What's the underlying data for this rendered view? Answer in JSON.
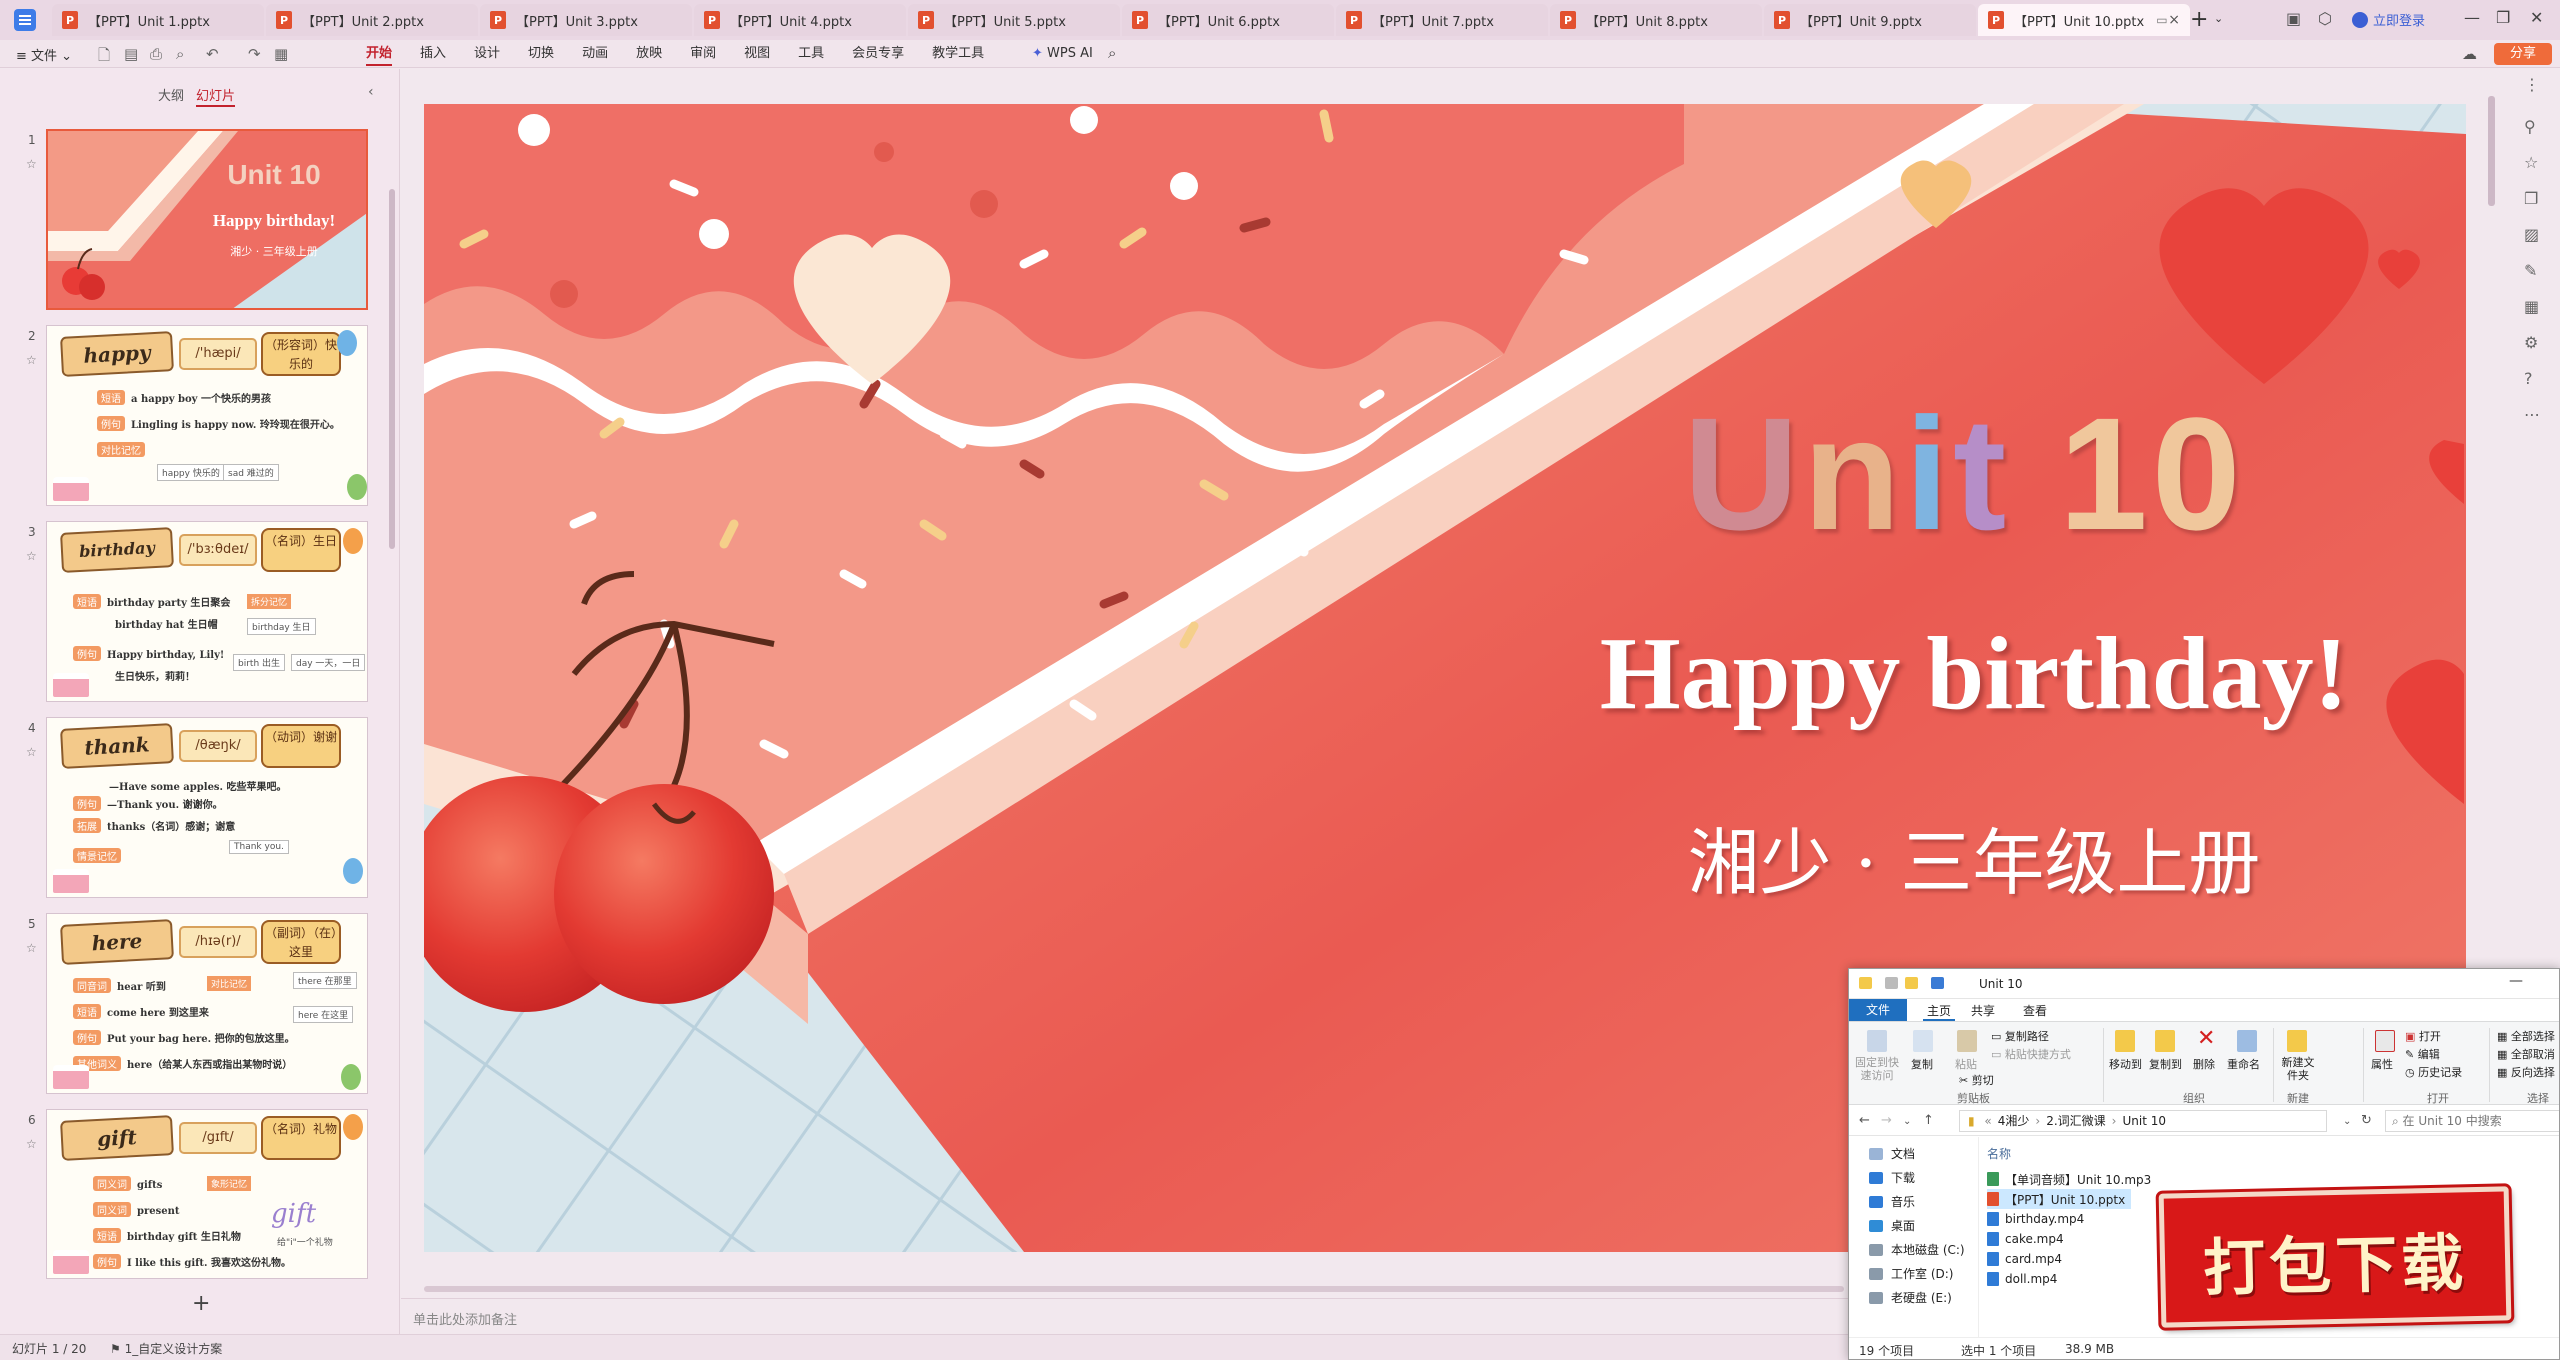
{
  "tabbar": {
    "tabs": [
      {
        "label": "【PPT】Unit 1.pptx",
        "icon": "ppt-icon"
      },
      {
        "label": "【PPT】Unit 2.pptx",
        "icon": "ppt-icon"
      },
      {
        "label": "【PPT】Unit 3.pptx",
        "icon": "ppt-icon"
      },
      {
        "label": "【PPT】Unit 4.pptx",
        "icon": "ppt-icon"
      },
      {
        "label": "【PPT】Unit 5.pptx",
        "icon": "ppt-icon"
      },
      {
        "label": "【PPT】Unit 6.pptx",
        "icon": "ppt-icon"
      },
      {
        "label": "【PPT】Unit 7.pptx",
        "icon": "ppt-icon"
      },
      {
        "label": "【PPT】Unit 8.pptx",
        "icon": "ppt-icon"
      },
      {
        "label": "【PPT】Unit 9.pptx",
        "icon": "ppt-icon"
      },
      {
        "label": "【PPT】Unit 10.pptx",
        "icon": "ppt-icon",
        "active": true
      }
    ],
    "ppt_icon_letter": "P",
    "login_label": "立即登录"
  },
  "menubar": {
    "file_label": "≡ 文件 ⌄",
    "menus": [
      "开始",
      "插入",
      "设计",
      "切换",
      "动画",
      "放映",
      "审阅",
      "视图",
      "工具",
      "会员专享",
      "教学工具"
    ],
    "active_menu": "开始",
    "wps_ai_label": "WPS AI",
    "share_label": "分享"
  },
  "leftpanel": {
    "tab_outline": "大纲",
    "tab_slides": "幻灯片",
    "slides": [
      {
        "num": "1",
        "unit": "Unit 10",
        "happy": "Happy birthday!",
        "cn": "湘少 · 三年级上册"
      },
      {
        "num": "2",
        "word": "happy",
        "phonetic": "/'hæpi/",
        "pos": "（形容词）快乐的",
        "lines": [
          {
            "label": "短语",
            "text": "a happy boy 一个快乐的男孩"
          },
          {
            "label": "例句",
            "text": "Lingling is happy now. 玲玲现在很开心。"
          },
          {
            "label": "对比记忆",
            "text": ""
          }
        ],
        "notes": [
          "happy 快乐的",
          "sad 难过的"
        ]
      },
      {
        "num": "3",
        "word": "birthday",
        "phonetic": "/'bɜːθdeɪ/",
        "pos": "（名词）生日",
        "lines": [
          {
            "label": "短语",
            "text": "birthday party 生日聚会"
          },
          {
            "label": "",
            "text": "birthday hat 生日帽"
          },
          {
            "label": "例句",
            "text": "Happy birthday, Lily!"
          },
          {
            "label": "",
            "text": "生日快乐，莉莉！"
          }
        ],
        "notes": [
          "拆分记忆",
          "birthday 生日",
          "birth 出生",
          "day 一天，一日"
        ]
      },
      {
        "num": "4",
        "word": "thank",
        "phonetic": "/θæŋk/",
        "pos": "（动词）谢谢",
        "lines": [
          {
            "label": "例句",
            "text": "—Have some apples. 吃些苹果吧。"
          },
          {
            "label": "",
            "text": "—Thank you. 谢谢你。"
          },
          {
            "label": "拓展",
            "text": "thanks（名词）感谢；谢意"
          },
          {
            "label": "情景记忆",
            "text": ""
          }
        ],
        "notes": [
          "Thank you."
        ]
      },
      {
        "num": "5",
        "word": "here",
        "phonetic": "/hɪə(r)/",
        "pos": "（副词）（在）这里",
        "lines": [
          {
            "label": "同音词",
            "text": "hear 听到"
          },
          {
            "label": "短语",
            "text": "come here 到这里来"
          },
          {
            "label": "例句",
            "text": "Put your bag here. 把你的包放这里。"
          },
          {
            "label": "其他词义",
            "text": "here（给某人东西或指出某物时说）"
          }
        ],
        "notes": [
          "对比记忆",
          "there 在那里",
          "here 在这里"
        ]
      },
      {
        "num": "6",
        "word": "gift",
        "phonetic": "/gɪft/",
        "pos": "（名词）礼物",
        "lines": [
          {
            "label": "同义词",
            "text": "gifts"
          },
          {
            "label": "同义词",
            "text": "present"
          },
          {
            "label": "短语",
            "text": "birthday gift 生日礼物"
          },
          {
            "label": "例句",
            "text": "I like this gift. 我喜欢这份礼物。"
          }
        ],
        "notes": [
          "象形记忆",
          "gift",
          "给\"i\"一个礼物"
        ]
      }
    ]
  },
  "slide": {
    "title_parts": [
      "U",
      "n",
      "i",
      "t",
      " 10"
    ],
    "happy": "Happy birthday!",
    "cn": "湘少 · 三年级上册"
  },
  "notes": {
    "placeholder": "单击此处添加备注"
  },
  "statusbar": {
    "slide_info": "幻灯片 1 / 20",
    "design": "1_自定义设计方案"
  },
  "explorer": {
    "title": "Unit 10",
    "ribbon_tabs": [
      "文件",
      "主页",
      "共享",
      "查看"
    ],
    "ribbon": {
      "pin": "固定到快速访问",
      "copy": "复制",
      "paste": "粘贴",
      "copy_path": "复制路径",
      "paste_shortcut": "粘贴快捷方式",
      "cut": "剪切",
      "move_to": "移动到",
      "copy_to": "复制到",
      "delete": "删除",
      "rename": "重命名",
      "new_folder": "新建文件夹",
      "properties": "属性",
      "open": "打开",
      "edit": "编辑",
      "history": "历史记录",
      "select_all": "全部选择",
      "select_none": "全部取消",
      "invert": "反向选择",
      "groups": [
        "剪贴板",
        "组织",
        "新建",
        "打开",
        "选择"
      ]
    },
    "address": [
      "4湘少",
      "2.词汇微课",
      "Unit 10"
    ],
    "search_placeholder": "在 Unit 10 中搜索",
    "nav": [
      "文档",
      "下载",
      "音乐",
      "桌面",
      "本地磁盘 (C:)",
      "工作室 (D:)",
      "老硬盘 (E:)"
    ],
    "column_name": "名称",
    "files": [
      {
        "name": "【单词音频】Unit 10.mp3",
        "type": "audio"
      },
      {
        "name": "【PPT】Unit 10.pptx",
        "type": "ppt",
        "selected": true
      },
      {
        "name": "birthday.mp4",
        "type": "video"
      },
      {
        "name": "cake.mp4",
        "type": "video"
      },
      {
        "name": "card.mp4",
        "type": "video"
      },
      {
        "name": "doll.mp4",
        "type": "video"
      }
    ],
    "status": {
      "count": "19 个项目",
      "selected": "选中 1 个项目",
      "size": "38.9 MB"
    }
  },
  "badge": {
    "text": "打包下载"
  },
  "colors": {
    "accent": "#c2222d",
    "ppt": "#e2502f",
    "explorer_blue": "#1f6fbf",
    "badge_red": "#d81818"
  }
}
